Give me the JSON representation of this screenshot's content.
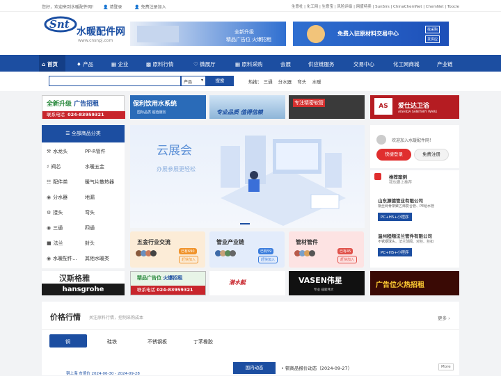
{
  "topbar": {
    "welcome": "您好，欢迎来到水暖配件网！",
    "login": "请登录",
    "register": "免费注册加入",
    "links": "生意社 | 化工网 | 生意宝 | 风险评级 | 网盛特卖 | SunSirs | ChinaChemNet | ChemNet | Toocle"
  },
  "header": {
    "site_name": "水暖配件网",
    "site_url": "www.cnsnpj.com",
    "banner1_text1": "全新升级",
    "banner1_text2": "精品广告位 火爆招租",
    "banner2_text": "免费入驻原材料交易中心",
    "banner2_tag1": "找采购",
    "banner2_tag2": "发供应"
  },
  "nav": [
    "首页",
    "产品",
    "企业",
    "原料行情",
    "微展厅",
    "原料采购",
    "会展",
    "供应链服务",
    "交易中心",
    "化工网商城",
    "产业链"
  ],
  "search": {
    "select": "产品",
    "button": "搜索",
    "hot_label": "热搜：",
    "hot_items": [
      "三通",
      "分水器",
      "弯头",
      "水暖"
    ]
  },
  "ads_top": [
    {
      "t1": "全新升级",
      "t2": "广告招租",
      "phone_label": "联系电话",
      "phone": "024-83959321"
    },
    {
      "t1": "保利饮用水系统",
      "t2": "国际品质 超值服务"
    },
    {
      "t1": "专业品质 值得信赖"
    },
    {
      "t1": "专注精密软管"
    },
    {
      "t1": "爱仕达卫浴",
      "t2": "AISHIDA SANITARY WARE"
    }
  ],
  "category": {
    "title": "全部商品分类",
    "items": [
      [
        "水龙头",
        "PP-R管件"
      ],
      [
        "阀芯",
        "水暖五金"
      ],
      [
        "配件类",
        "暖气片散热器"
      ],
      [
        "分水器",
        "地漏"
      ],
      [
        "接头",
        "弯头"
      ],
      [
        "三通",
        "四通"
      ],
      [
        "法兰",
        "封头"
      ],
      [
        "水暖配件...",
        "其他水暖类"
      ]
    ]
  },
  "carousel": {
    "title": "云展会",
    "subtitle": "办展参展更轻松"
  },
  "mini_cards": [
    {
      "title": "五金行业交流",
      "count": "已有690",
      "btn": "赶快加入"
    },
    {
      "title": "管业产业链",
      "count": "已有59",
      "btn": "赶快加入"
    },
    {
      "title": "管材管件",
      "count": "已有45",
      "btn": "赶快加入"
    }
  ],
  "user": {
    "welcome": "欢迎加入水暖配件网！",
    "login_btn": "快捷登录",
    "register_btn": "免费注册"
  },
  "recommend": {
    "title": "推荐案例",
    "subtitle": "我也要上推荐",
    "items": [
      {
        "name": "山东源德管业有限公司",
        "desc": "钢丝网骨架聚乙烯复合管、PE给水管",
        "tag": "PC+H5+小程序"
      },
      {
        "name": "温州程翔法兰管件有限公司",
        "desc": "不锈钢球头、法兰球阀、对丝、丝扣",
        "tag": "PC+H5+小程序"
      }
    ]
  },
  "ads_mid": [
    {
      "t1": "汉斯格雅",
      "t2": "hansgrohe"
    },
    {
      "t1": "精品广告位",
      "t2": "火爆招租",
      "phone_label": "联系电话",
      "phone": "024-83959321"
    },
    {
      "t1": "潜水艇"
    },
    {
      "t1": "VASEN伟星",
      "t2": "专业 成就伟大"
    },
    {
      "t1": "广告位火热招租"
    }
  ],
  "price": {
    "title": "价格行情",
    "subtitle": "关注原料行情，控制采购成本",
    "more": "更多",
    "tabs": [
      "铜",
      "硅铁",
      "不锈钢板",
      "丁苯橡胶"
    ],
    "sub_left": "铜上海 市场价 2024-06-30 - 2024-09-28",
    "domestic": "国内动态",
    "news": "铜商品报价动态（2024-09-27）",
    "news_more": "More"
  },
  "colors": {
    "primary": "#1c4ea1",
    "red": "#e02e2e"
  }
}
